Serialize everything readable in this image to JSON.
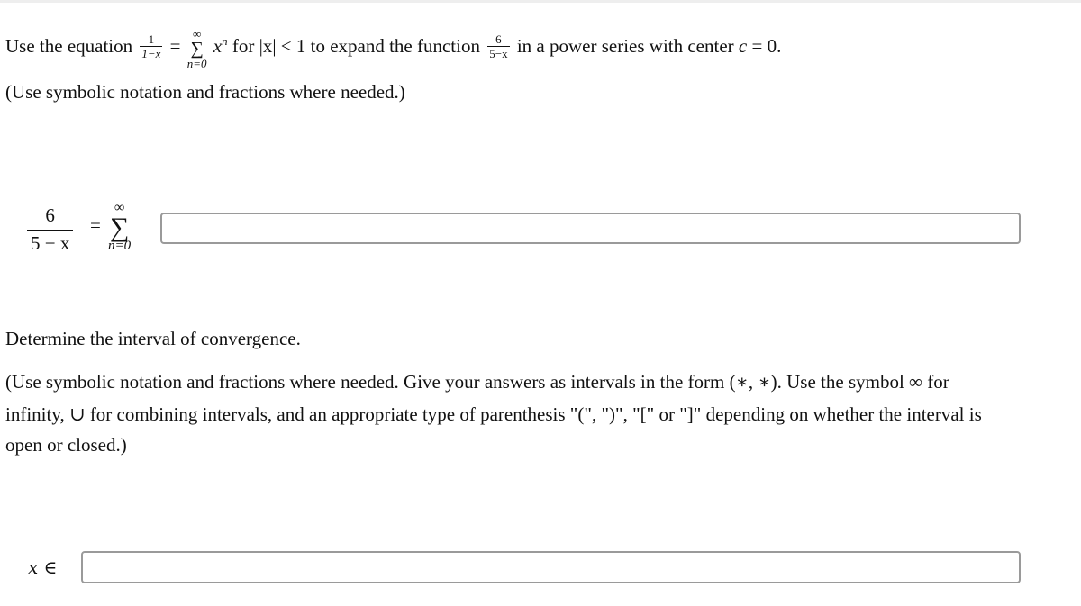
{
  "question": {
    "intro_prefix": "Use the equation",
    "given_fraction": {
      "numerator": "1",
      "denominator": "1−x"
    },
    "equals": "=",
    "given_sum": {
      "upper": "∞",
      "sigma": "∑",
      "lower": "n=0",
      "term_base": "x",
      "term_exp": "n"
    },
    "condition_text": "for |x| < 1 to expand the function",
    "target_fraction": {
      "numerator": "6",
      "denominator": "5−x"
    },
    "intro_suffix": "in a power series with center",
    "center_var": "c",
    "center_value": "= 0.",
    "hint1": "(Use symbolic notation and fractions where needed.)"
  },
  "part1": {
    "lhs_fraction": {
      "numerator": "6",
      "denominator": "5 − x"
    },
    "equals": "=",
    "sum": {
      "upper": "∞",
      "sigma": "∑",
      "lower": "n=0"
    },
    "answer_value": "",
    "answer_placeholder": ""
  },
  "part2": {
    "prompt": "Determine the interval of convergence.",
    "hint_line1": "(Use symbolic notation and fractions where needed. Give your answers as intervals in the form (∗, ∗). Use the symbol ∞ for",
    "hint_line2": "infinity, ∪ for combining intervals, and an appropriate type of parenthesis \"(\", \")\", \"[\" or \"]\" depending on whether the interval is",
    "hint_line3": "open or closed.)",
    "answer_label": "x ∈",
    "answer_value": "",
    "answer_placeholder": ""
  }
}
